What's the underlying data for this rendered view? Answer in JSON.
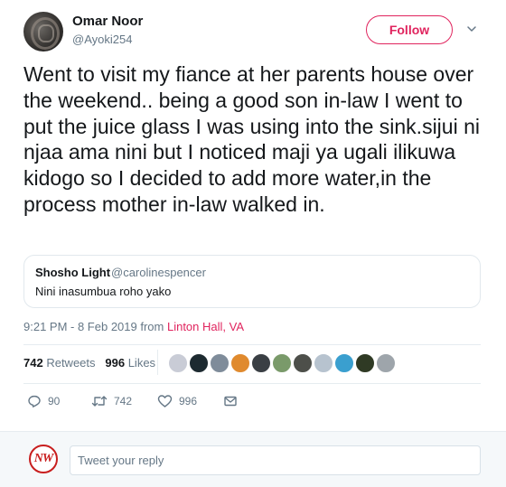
{
  "author": {
    "display_name": "Omar Noor",
    "handle": "@Ayoki254"
  },
  "follow_label": "Follow",
  "tweet_text": "Went to visit my fiance at her parents house over the weekend.. being a good son in-law I went to put the juice glass I was using into the sink.sijui ni njaa ama nini but I noticed maji ya ugali ilikuwa kidogo so I decided to add more water,in the process mother in-law walked in.",
  "quoted_tweet": {
    "name": "Shosho Light",
    "handle": "@carolinespencer",
    "text": "Nini inasumbua roho yako"
  },
  "meta": {
    "time": "9:21 PM - 8 Feb 2019 from ",
    "location": "Linton Hall, VA"
  },
  "stats": {
    "retweets_count": "742",
    "retweets_label": "Retweets",
    "likes_count": "996",
    "likes_label": "Likes"
  },
  "liker_avatar_colors": [
    "#c9ccd6",
    "#1d2a30",
    "#7f8c9a",
    "#e08a2e",
    "#3a3f44",
    "#7a9a6a",
    "#4d4f4a",
    "#b7c3cf",
    "#3a9fcf",
    "#2f3a24",
    "#9ea5ab"
  ],
  "actions": {
    "replies": "90",
    "retweets": "742",
    "likes": "996"
  },
  "reply": {
    "avatar_text": "NW",
    "placeholder": "Tweet your reply"
  },
  "colors": {
    "accent": "#e0245e",
    "muted": "#657786",
    "text": "#14171a"
  }
}
